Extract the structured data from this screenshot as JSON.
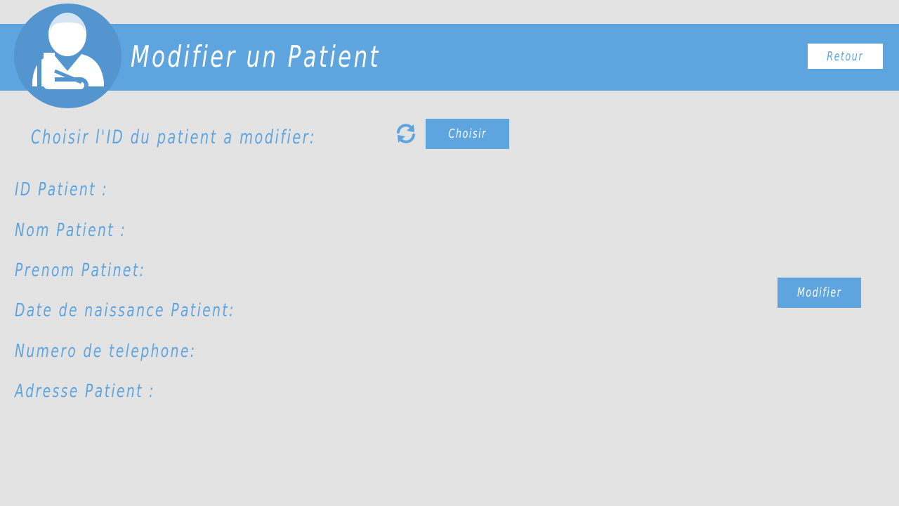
{
  "header": {
    "title": "Modifier un Patient",
    "back_button_label": "Retour",
    "avatar_icon": "patient-icon"
  },
  "selection": {
    "label": "Choisir l'ID du patient a modifier:",
    "refresh_icon": "refresh-icon",
    "choose_button_label": "Choisir"
  },
  "fields": {
    "id_label": "ID Patient :",
    "nom_label": "Nom Patient :",
    "prenom_label": "Prenom Patinet:",
    "date_label": "Date de naissance Patient:",
    "telephone_label": "Numero de telephone:",
    "adresse_label": "Adresse Patient :"
  },
  "actions": {
    "modify_button_label": "Modifier"
  },
  "colors": {
    "accent": "#5ea4df",
    "avatar_bg": "#5495cf",
    "background": "#e3e3e3",
    "white": "#ffffff"
  }
}
